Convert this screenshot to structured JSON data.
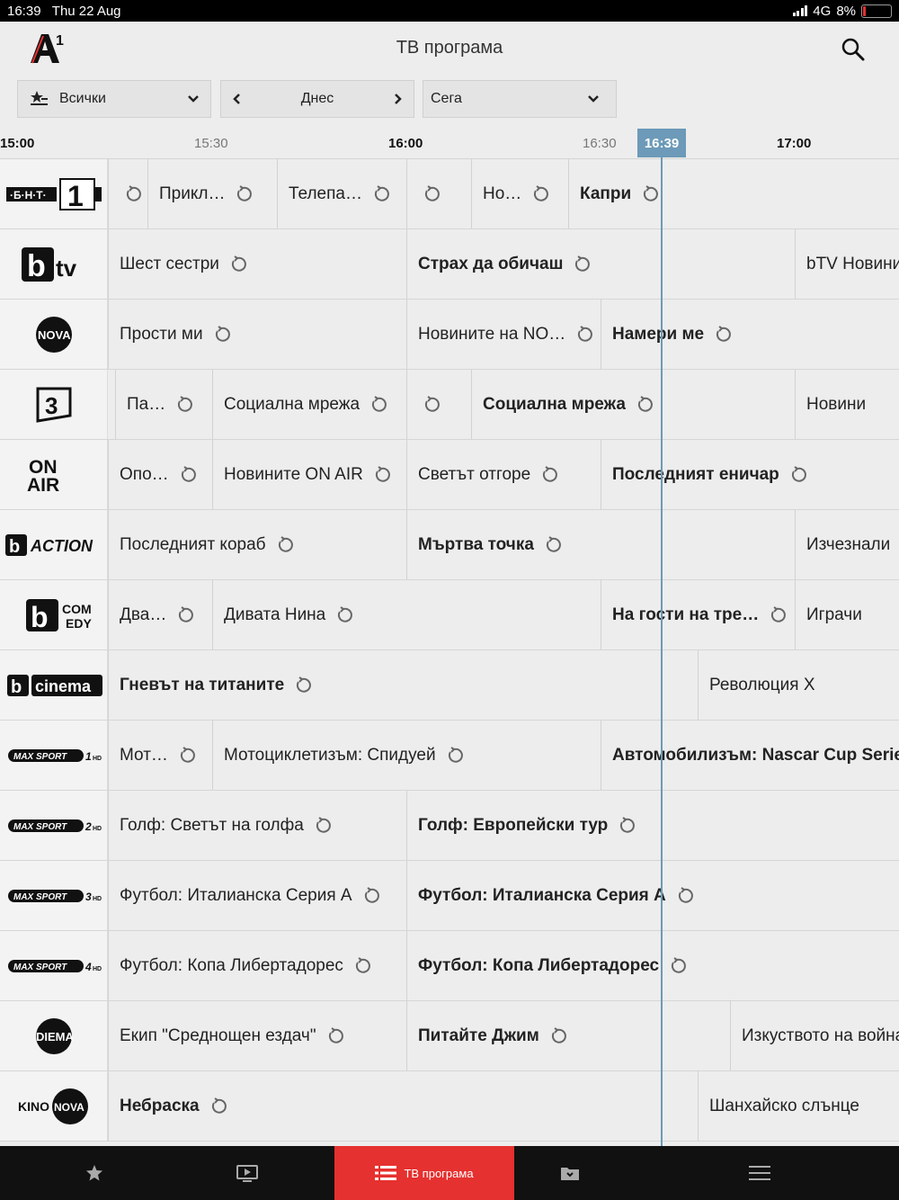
{
  "status_bar": {
    "time": "16:39",
    "date": "Thu 22 Aug",
    "network": "4G",
    "battery": "8%"
  },
  "header": {
    "title": "ТВ програма"
  },
  "toolbar": {
    "filter": "Всички",
    "day": "Днес",
    "time": "Сега"
  },
  "timeline": {
    "ticks": [
      {
        "label": "15:00",
        "major": true
      },
      {
        "label": "15:30",
        "major": false
      },
      {
        "label": "16:00",
        "major": true
      },
      {
        "label": "16:30",
        "major": false
      },
      {
        "label": "17:00",
        "major": true
      }
    ],
    "now": "16:39"
  },
  "channels": [
    {
      "name": "bnt1",
      "programs": [
        {
          "title": "",
          "bold": false
        },
        {
          "title": "Прикл…",
          "bold": false
        },
        {
          "title": "Телепа…",
          "bold": false
        },
        {
          "title": "",
          "bold": false
        },
        {
          "title": "Но…",
          "bold": false
        },
        {
          "title": "Капри",
          "bold": true
        }
      ]
    },
    {
      "name": "btv",
      "programs": [
        {
          "title": "Шест сестри",
          "bold": false
        },
        {
          "title": "Страх да обичаш",
          "bold": true
        },
        {
          "title": "bTV Новинит",
          "bold": false
        }
      ]
    },
    {
      "name": "nova",
      "programs": [
        {
          "title": "Прости ми",
          "bold": false
        },
        {
          "title": "Новините на NO…",
          "bold": false
        },
        {
          "title": "Намери ме",
          "bold": true
        }
      ]
    },
    {
      "name": "bnt3",
      "programs": [
        {
          "title": "Па…",
          "bold": false
        },
        {
          "title": "Социална мрежа",
          "bold": false
        },
        {
          "title": "",
          "bold": false
        },
        {
          "title": "Социална мрежа",
          "bold": true
        },
        {
          "title": "Новини",
          "bold": false
        }
      ]
    },
    {
      "name": "onair",
      "programs": [
        {
          "title": "Опо…",
          "bold": false
        },
        {
          "title": "Новините ON AIR",
          "bold": false
        },
        {
          "title": "Светът отгоре",
          "bold": false
        },
        {
          "title": "Последният еничар",
          "bold": true
        }
      ]
    },
    {
      "name": "baction",
      "programs": [
        {
          "title": "Последният кораб",
          "bold": false
        },
        {
          "title": "Мъртва точка",
          "bold": true
        },
        {
          "title": "Изчезнали",
          "bold": false
        }
      ]
    },
    {
      "name": "bcomedy",
      "programs": [
        {
          "title": "Два…",
          "bold": false
        },
        {
          "title": "Дивата Нина",
          "bold": false
        },
        {
          "title": "На гости на тре…",
          "bold": true
        },
        {
          "title": "Играчи",
          "bold": false
        }
      ]
    },
    {
      "name": "bcinema",
      "programs": [
        {
          "title": "Гневът на титаните",
          "bold": true
        },
        {
          "title": "Революция X",
          "bold": false
        }
      ]
    },
    {
      "name": "maxsport1",
      "programs": [
        {
          "title": "Мот…",
          "bold": false
        },
        {
          "title": "Мотоциклетизъм: Спидуей",
          "bold": false
        },
        {
          "title": "Автомобилизъм: Nascar Cup Series",
          "bold": true
        }
      ]
    },
    {
      "name": "maxsport2",
      "programs": [
        {
          "title": "Голф: Светът на голфа",
          "bold": false
        },
        {
          "title": "Голф: Европейски тур",
          "bold": true
        }
      ]
    },
    {
      "name": "maxsport3",
      "programs": [
        {
          "title": "Футбол: Италианска Серия А",
          "bold": false
        },
        {
          "title": "Футбол: Италианска Серия А",
          "bold": true
        }
      ]
    },
    {
      "name": "maxsport4",
      "programs": [
        {
          "title": "Футбол: Копа Либертадорес",
          "bold": false
        },
        {
          "title": "Футбол: Копа Либертадорес",
          "bold": true
        }
      ]
    },
    {
      "name": "diema",
      "programs": [
        {
          "title": "Екип \"Среднощен ездач\"",
          "bold": false
        },
        {
          "title": "Питайте Джим",
          "bold": true
        },
        {
          "title": "Изкуството на война",
          "bold": false
        }
      ]
    },
    {
      "name": "kinonova",
      "programs": [
        {
          "title": "Небраска",
          "bold": true
        },
        {
          "title": "Шанхайско слънце",
          "bold": false
        }
      ]
    }
  ],
  "bottom_nav": [
    {
      "icon": "star-icon",
      "label": ""
    },
    {
      "icon": "tv-icon",
      "label": ""
    },
    {
      "icon": "list-icon",
      "label": "ТВ програма"
    },
    {
      "icon": "folder-icon",
      "label": ""
    },
    {
      "icon": "menu-icon",
      "label": ""
    }
  ],
  "colors": {
    "accent": "#e5312f",
    "now_line": "#6c9ab8"
  }
}
